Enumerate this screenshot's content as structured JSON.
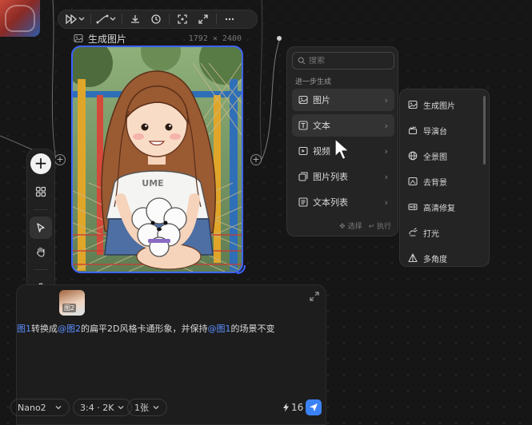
{
  "node": {
    "title": "生成图片",
    "dimensions": "1792 × 2400",
    "image_alt": "卡通风格女孩抱着白色泰迪犬",
    "shirt_text": "UME",
    "port_label": "+"
  },
  "toolbar": {
    "icons": [
      "play-icon",
      "chevron-down-icon",
      "curve-icon",
      "chevron-down-icon",
      "download-icon",
      "history-icon",
      "crop-icon",
      "expand-icon",
      "more-icon"
    ]
  },
  "left_toolbar": {
    "add_label": "+",
    "tools": [
      "grid-icon",
      "cursor-icon",
      "hand-icon",
      "camera-icon",
      "help-icon"
    ]
  },
  "generate_menu": {
    "search_placeholder": "搜索",
    "section_label": "进一步生成",
    "items": [
      {
        "label": "图片",
        "icon": "image-icon",
        "highlighted": true
      },
      {
        "label": "文本",
        "icon": "text-icon",
        "highlighted": true
      },
      {
        "label": "视频",
        "icon": "video-icon",
        "highlighted": false
      },
      {
        "label": "图片列表",
        "icon": "image-list-icon",
        "highlighted": false
      },
      {
        "label": "文本列表",
        "icon": "text-list-icon",
        "highlighted": false
      }
    ],
    "footer_select": "选择",
    "footer_execute": "执行"
  },
  "sub_menu": {
    "items": [
      {
        "label": "生成图片",
        "icon": "image-icon"
      },
      {
        "label": "导演台",
        "icon": "clapper-icon"
      },
      {
        "label": "全景图",
        "icon": "globe-icon"
      },
      {
        "label": "去背景",
        "icon": "remove-bg-icon"
      },
      {
        "label": "高清修复",
        "icon": "hd-icon"
      },
      {
        "label": "打光",
        "icon": "light-icon"
      },
      {
        "label": "多角度",
        "icon": "cube-icon"
      }
    ]
  },
  "prompt": {
    "ref_thumb_label": "图2",
    "segments": [
      {
        "text": "图1",
        "ref": true
      },
      {
        "text": "转换成",
        "ref": false
      },
      {
        "text": "@图2",
        "ref": true
      },
      {
        "text": "的扁平2D风格卡通形象，并保持",
        "ref": false
      },
      {
        "text": "@图1",
        "ref": true
      },
      {
        "text": "的场景不变",
        "ref": false
      }
    ],
    "model": "Nano2",
    "ratio": "3:4 · 2K",
    "count": "1张",
    "credits": "16"
  },
  "colors": {
    "accent": "#3d63ff",
    "ref_text": "#5b8dff",
    "send": "#3b82f6",
    "menu_bg": "#242424",
    "canvas_bg": "#161616"
  }
}
